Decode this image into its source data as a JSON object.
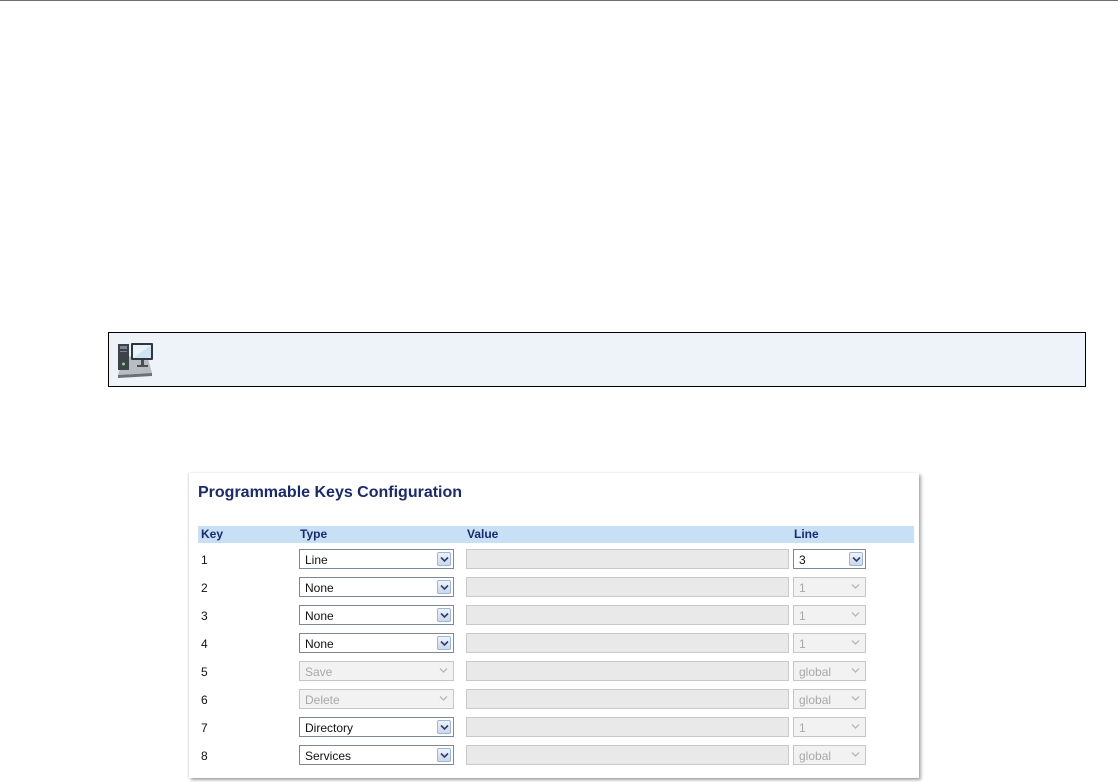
{
  "title": "Programmable Keys Configuration",
  "columns": {
    "key": "Key",
    "type": "Type",
    "value": "Value",
    "line": "Line"
  },
  "rows": [
    {
      "key": "1",
      "type": "Line",
      "type_enabled": true,
      "value": "",
      "line": "3",
      "line_enabled": true
    },
    {
      "key": "2",
      "type": "None",
      "type_enabled": true,
      "value": "",
      "line": "1",
      "line_enabled": false
    },
    {
      "key": "3",
      "type": "None",
      "type_enabled": true,
      "value": "",
      "line": "1",
      "line_enabled": false
    },
    {
      "key": "4",
      "type": "None",
      "type_enabled": true,
      "value": "",
      "line": "1",
      "line_enabled": false
    },
    {
      "key": "5",
      "type": "Save",
      "type_enabled": false,
      "value": "",
      "line": "global",
      "line_enabled": false
    },
    {
      "key": "6",
      "type": "Delete",
      "type_enabled": false,
      "value": "",
      "line": "global",
      "line_enabled": false
    },
    {
      "key": "7",
      "type": "Directory",
      "type_enabled": true,
      "value": "",
      "line": "1",
      "line_enabled": false
    },
    {
      "key": "8",
      "type": "Services",
      "type_enabled": true,
      "value": "",
      "line": "global",
      "line_enabled": false
    }
  ],
  "icons": {
    "note": "computer-monitor-icon",
    "dropdown": "chevron-down-icon"
  },
  "colors": {
    "title": "#1b2a6e",
    "header_bg": "#c7e0f5",
    "note_bg": "#eef2f9"
  }
}
